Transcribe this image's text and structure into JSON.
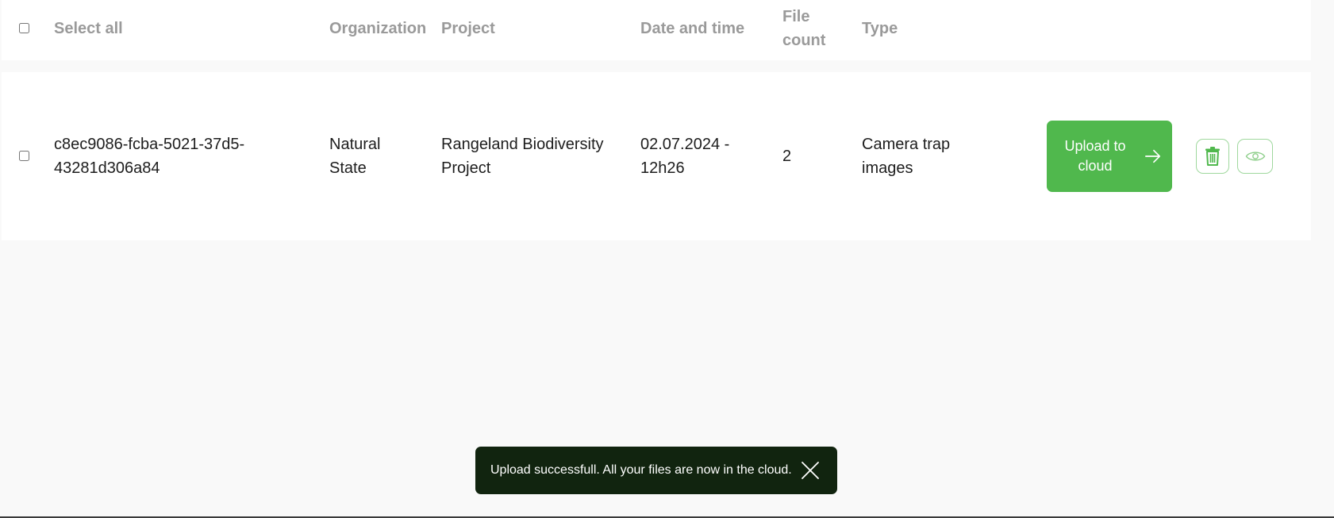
{
  "table": {
    "header": {
      "select_all_label": "Select all",
      "columns": {
        "organization": "Organization",
        "project": "Project",
        "date_time": "Date and time",
        "file_count_line1": "File",
        "file_count_line2": "count",
        "type": "Type"
      }
    },
    "rows": [
      {
        "id_line1": "c8ec9086-fcba-5021-37d5-",
        "id_line2": "43281d306a84",
        "organization_line1": "Natural",
        "organization_line2": "State",
        "project_line1": "Rangeland Biodiversity",
        "project_line2": "Project",
        "date_line1": "02.07.2024 -",
        "date_line2": "12h26",
        "file_count": "2",
        "type_line1": "Camera trap",
        "type_line2": "images",
        "upload_label_line1": "Upload to",
        "upload_label_line2": "cloud",
        "icons": {
          "upload": "arrow-right-icon",
          "delete": "trash-icon",
          "view": "eye-icon"
        }
      }
    ]
  },
  "toast": {
    "message": "Upload successfull. All your files are now in the cloud.",
    "close_icon": "close-icon"
  },
  "colors": {
    "accent_green": "#50b84d",
    "icon_border_green": "#9fd89d",
    "toast_bg": "#11240f",
    "header_text": "#9a9a9a",
    "body_text": "#1d1d1d",
    "page_bg": "#f9f9f9"
  }
}
